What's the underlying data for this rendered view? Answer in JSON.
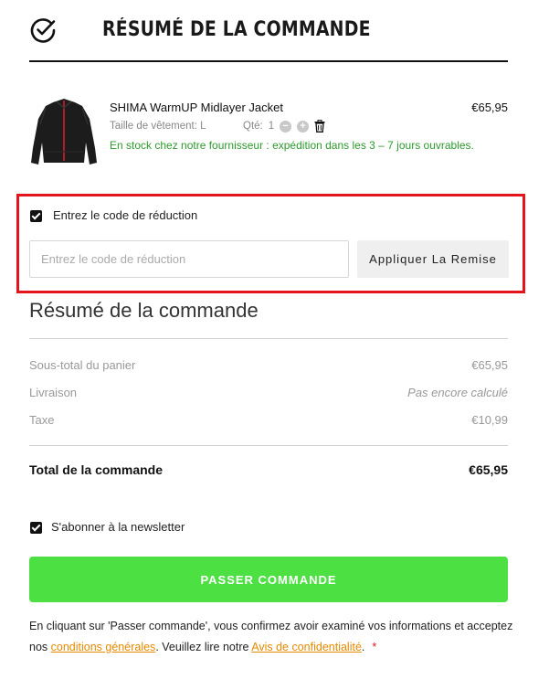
{
  "header": {
    "title": "RÉSUMÉ DE LA COMMANDE",
    "icon": "check-circle-icon"
  },
  "product": {
    "name": "SHIMA WarmUP Midlayer Jacket",
    "price": "€65,95",
    "size_text": "Taille de vêtement: L",
    "qty_label": "Qté:",
    "qty": "1",
    "stock": "En stock chez notre fournisseur : expédition dans les 3 – 7 jours ouvrables."
  },
  "discount": {
    "checkbox_label": "Entrez le code de réduction",
    "checked": true,
    "placeholder": "Entrez le code de réduction",
    "value": "",
    "apply_label": "Appliquer La Remise"
  },
  "summary": {
    "title": "Résumé de la commande",
    "subtotal_label": "Sous-total du panier",
    "subtotal_value": "€65,95",
    "shipping_label": "Livraison",
    "shipping_value": "Pas encore calculé",
    "tax_label": "Taxe",
    "tax_value": "€10,99",
    "total_label": "Total de la commande",
    "total_value": "€65,95"
  },
  "newsletter": {
    "label": "S'abonner à la newsletter",
    "checked": true
  },
  "order_button": "PASSER COMMANDE",
  "legal": {
    "part1": "En cliquant sur 'Passer commande', vous confirmez avoir examiné vos informations et acceptez nos ",
    "terms_link": "conditions générales",
    "part2": ". Veuillez lire notre ",
    "privacy_link": "Avis de confidentialité",
    "part3": ".",
    "required_mark": "*"
  },
  "colors": {
    "accent_green": "#4ce043",
    "stock_green": "#2e9b2e",
    "highlight_red": "#e5131b",
    "link_orange": "#e58a00"
  }
}
